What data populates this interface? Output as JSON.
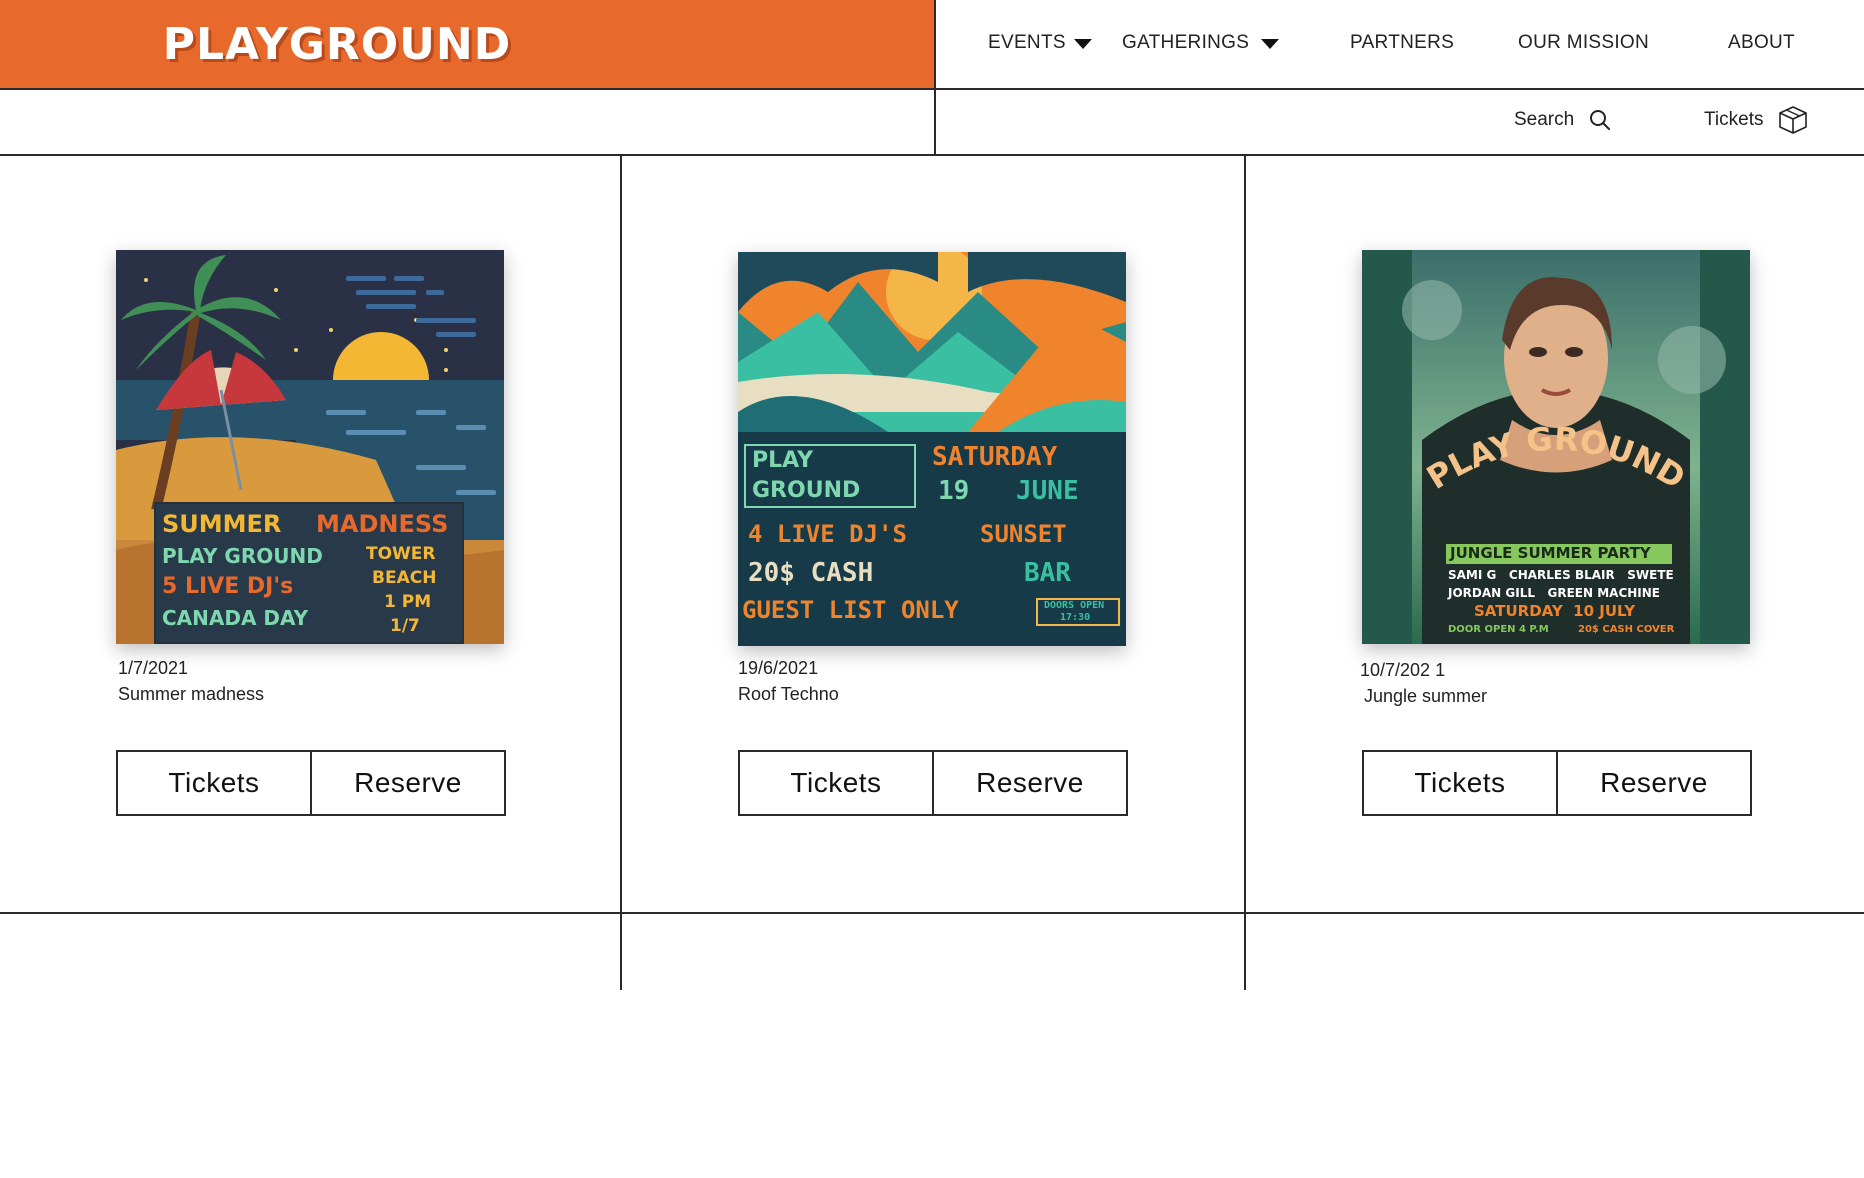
{
  "brand": {
    "logo": "PLAYGROUND",
    "accent": "#e8692c"
  },
  "nav": {
    "items": [
      {
        "label": "EVENTS",
        "has_dropdown": true
      },
      {
        "label": "GATHERINGS",
        "has_dropdown": true
      },
      {
        "label": "PARTNERS"
      },
      {
        "label": "OUR MISSION"
      },
      {
        "label": "ABOUT"
      }
    ]
  },
  "toolbar": {
    "search_label": "Search",
    "search_icon": "search-icon",
    "tickets_label": "Tickets",
    "tickets_icon": "box-icon"
  },
  "events": [
    {
      "date": "1/7/2021",
      "title": "Summer madness",
      "poster": {
        "headline_left": "SUMMER",
        "headline_right": "MADNESS",
        "line1": "PLAY GROUND",
        "line2": "5 LIVE DJ's",
        "line3": "CANADA DAY",
        "side1": "TOWER",
        "side2": "BEACH",
        "side3": "1 PM",
        "side4": "1/7"
      },
      "tickets_label": "Tickets",
      "reserve_label": "Reserve"
    },
    {
      "date": "19/6/2021",
      "title": "Roof Techno",
      "poster": {
        "brand1": "PLAY",
        "brand2": "GROUND",
        "day": "SATURDAY",
        "date1": "19",
        "date2": "JUNE",
        "line1_left": "4 LIVE DJ'S",
        "line1_right": "SUNSET",
        "line2_left": "20$ CASH",
        "line2_right": "BAR",
        "line3": "GUEST LIST ONLY",
        "doors1": "DOORS OPEN",
        "doors2": "17:30"
      },
      "tickets_label": "Tickets",
      "reserve_label": "Reserve"
    },
    {
      "date": "10/7/202 1",
      "title": "Jungle summer",
      "poster": {
        "arc": "PLAY GROUND",
        "sub": "JUNGLE SUMMER PARTY",
        "names1": "SAMI G   CHARLES BLAIR   SWETE",
        "names2": "JORDAN GILL   GREEN MACHINE",
        "date": "SATURDAY  10 JULY",
        "door": "DOOR OPEN 4 P.M",
        "cover": "20$ CASH COVER"
      },
      "tickets_label": "Tickets",
      "reserve_label": "Reserve"
    }
  ]
}
